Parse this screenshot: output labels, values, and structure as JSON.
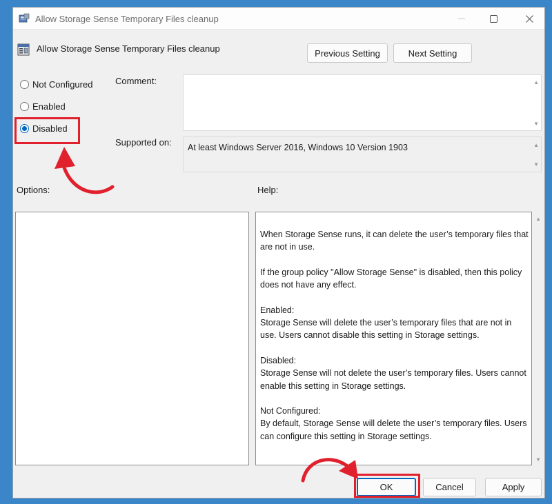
{
  "window": {
    "title": "Allow Storage Sense Temporary Files cleanup",
    "controls": {
      "minimize_icon": "minimize-icon",
      "maximize_icon": "maximize-icon",
      "close_icon": "close-icon"
    }
  },
  "header": {
    "policy_name": "Allow Storage Sense Temporary Files cleanup",
    "previous_setting": "Previous Setting",
    "next_setting": "Next Setting"
  },
  "state": {
    "options": [
      {
        "label": "Not Configured",
        "checked": false
      },
      {
        "label": "Enabled",
        "checked": false
      },
      {
        "label": "Disabled",
        "checked": true
      }
    ]
  },
  "comment": {
    "label": "Comment:",
    "value": ""
  },
  "supported_on": {
    "label": "Supported on:",
    "value": "At least Windows Server 2016, Windows 10 Version 1903"
  },
  "options_panel": {
    "label": "Options:"
  },
  "help_panel": {
    "label": "Help:",
    "paragraphs": [
      "When Storage Sense runs, it can delete the user’s temporary files that are not in use.",
      "If the group policy \"Allow Storage Sense\" is disabled, then this policy does not have any effect.",
      "Enabled:\nStorage Sense will delete the user’s temporary files that are not in use. Users cannot disable this setting in Storage settings.",
      "Disabled:\nStorage Sense will not delete the user’s temporary files. Users cannot enable this setting in Storage settings.",
      "Not Configured:\nBy default, Storage Sense will delete the user’s temporary files. Users can configure this setting in Storage settings."
    ]
  },
  "footer": {
    "ok": "OK",
    "cancel": "Cancel",
    "apply": "Apply"
  },
  "annotation_colors": {
    "highlight": "#e0202c",
    "selected_radio": "#0067c0"
  }
}
